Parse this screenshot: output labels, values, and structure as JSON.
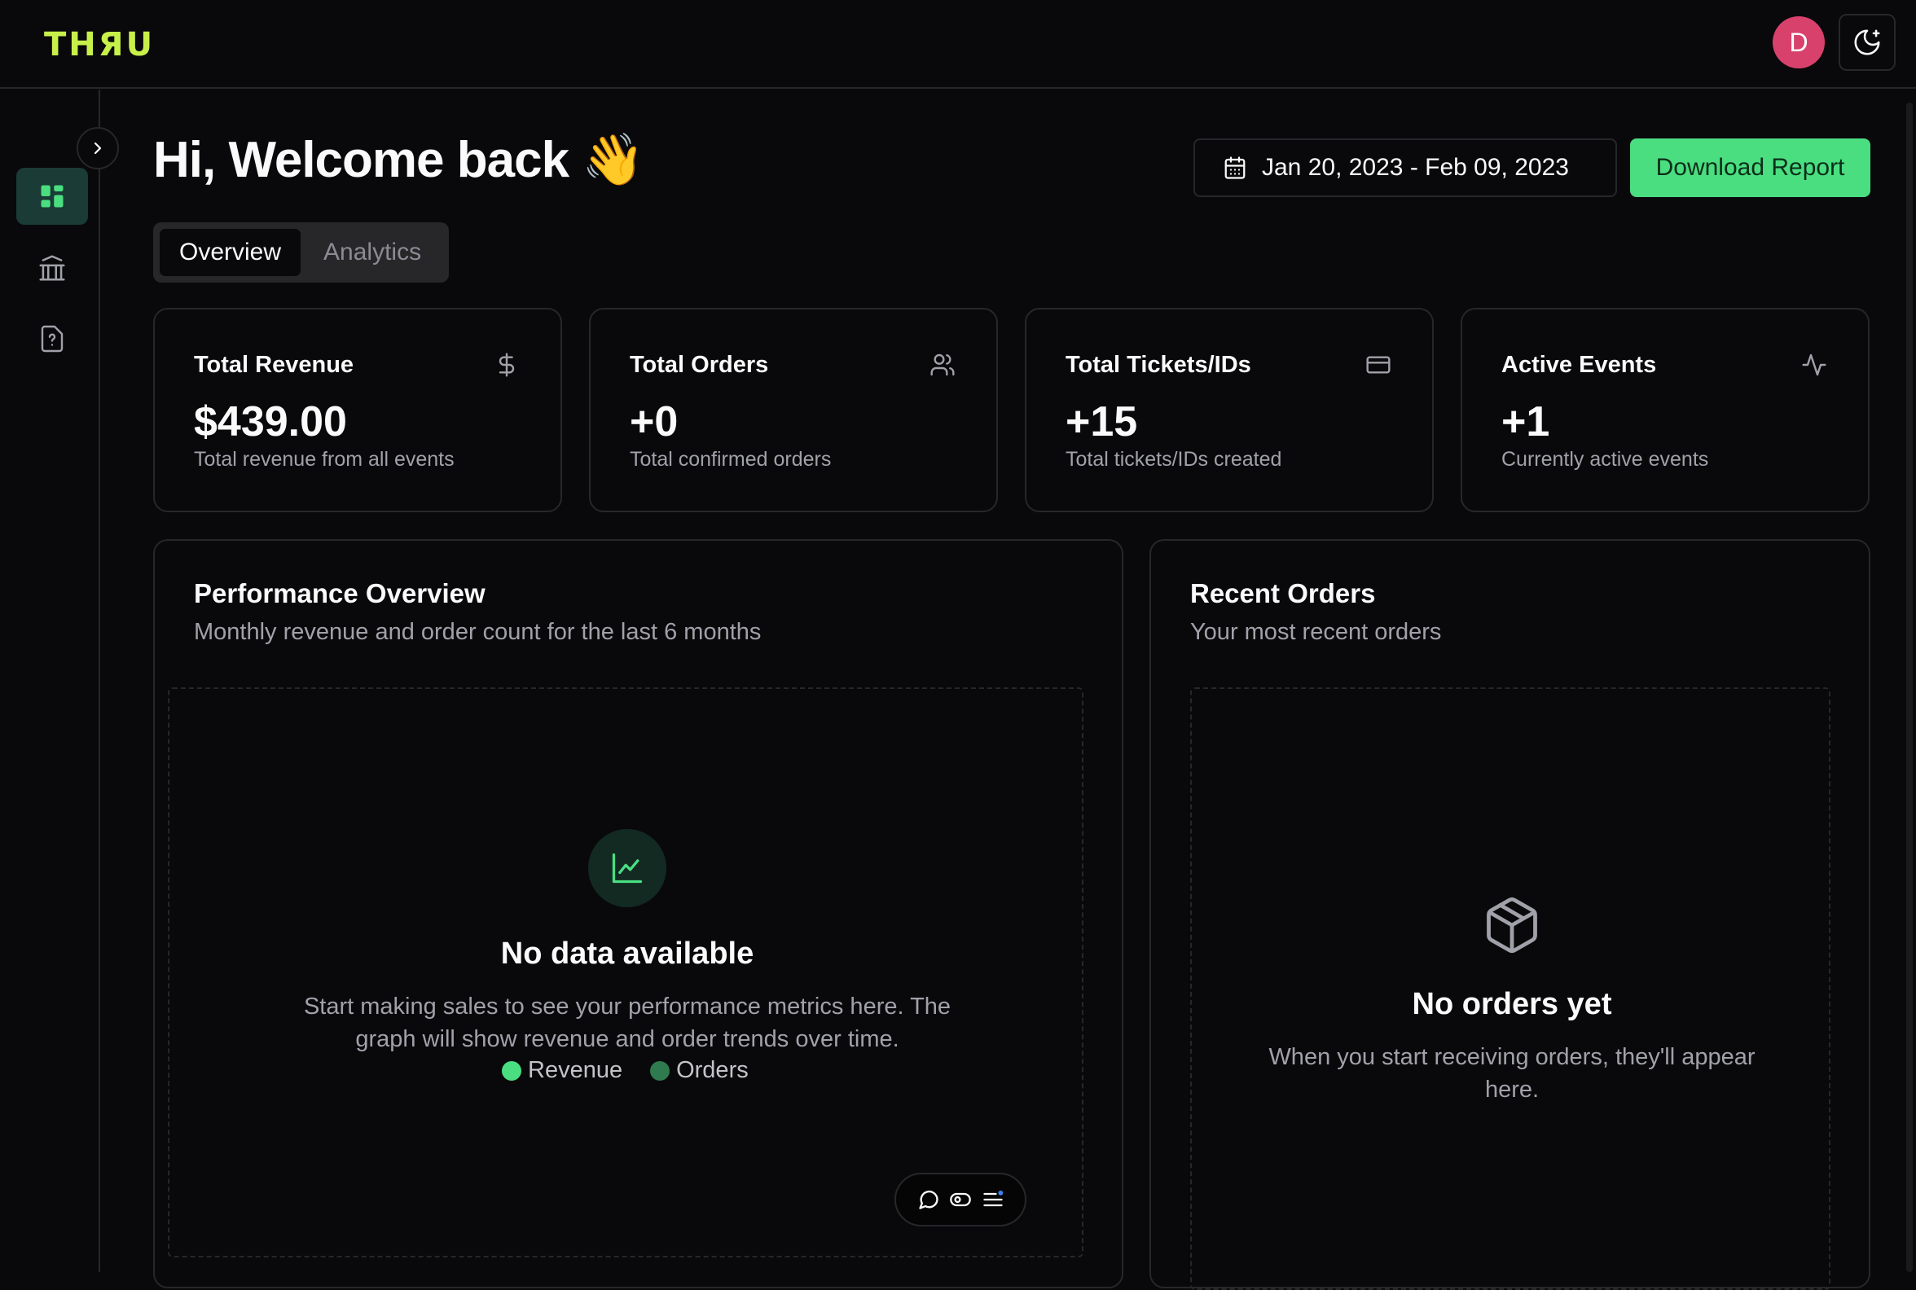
{
  "header": {
    "logo": "THЯU",
    "avatar_initial": "D"
  },
  "page": {
    "title": "Hi, Welcome back 👋",
    "date_range": "Jan 20, 2023 - Feb 09, 2023",
    "download_label": "Download Report",
    "tabs": [
      {
        "label": "Overview",
        "active": true
      },
      {
        "label": "Analytics",
        "active": false
      }
    ]
  },
  "stats": [
    {
      "label": "Total Revenue",
      "value": "$439.00",
      "desc": "Total revenue from all events",
      "icon": "dollar-icon"
    },
    {
      "label": "Total Orders",
      "value": "+0",
      "desc": "Total confirmed orders",
      "icon": "users-icon"
    },
    {
      "label": "Total Tickets/IDs",
      "value": "+15",
      "desc": "Total tickets/IDs created",
      "icon": "card-icon"
    },
    {
      "label": "Active Events",
      "value": "+1",
      "desc": "Currently active events",
      "icon": "activity-icon"
    }
  ],
  "performance": {
    "title": "Performance Overview",
    "subtitle": "Monthly revenue and order count for the last 6 months",
    "empty_title": "No data available",
    "empty_desc": "Start making sales to see your performance metrics here. The graph will show revenue and order trends over time.",
    "legend": [
      {
        "label": "Revenue",
        "color": "#4ade80"
      },
      {
        "label": "Orders",
        "color": "#2f7a4e"
      }
    ]
  },
  "recent_orders": {
    "title": "Recent Orders",
    "subtitle": "Your most recent orders",
    "empty_title": "No orders yet",
    "empty_desc": "When you start receiving orders, they'll appear here."
  },
  "colors": {
    "accent": "#4ade80",
    "logo": "#c8f04a",
    "avatar": "#d9416d",
    "nav_active": "#1a3b36"
  }
}
